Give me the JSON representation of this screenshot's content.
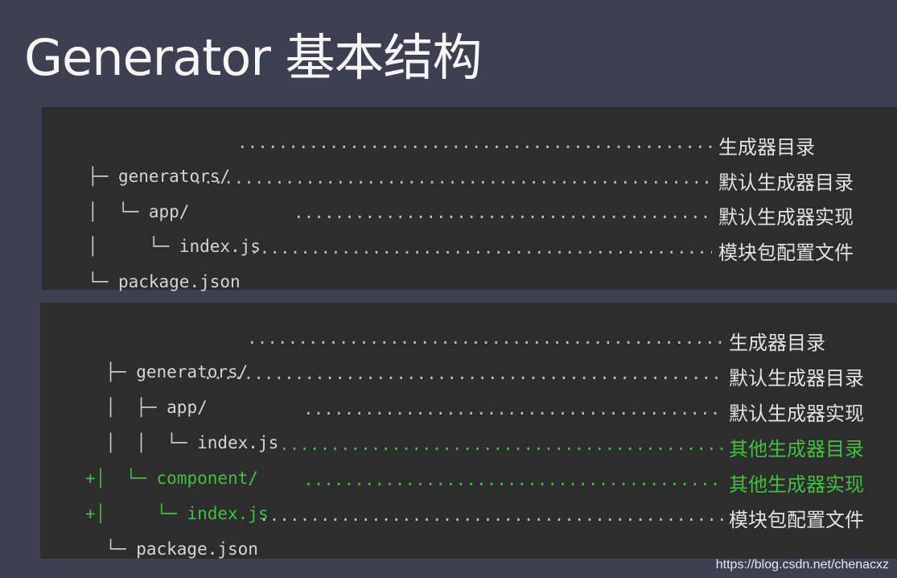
{
  "title": "Generator 基本结构",
  "tree_basic": [
    {
      "prefix": "├─ ",
      "name": "generators/",
      "dots": "································································",
      "desc": "生成器目录"
    },
    {
      "prefix": "│  └─ ",
      "name": "app/",
      "dots": "································································",
      "desc": "默认生成器目录"
    },
    {
      "prefix": "│     └─ ",
      "name": "index.js",
      "dots": "································································",
      "desc": "默认生成器实现"
    },
    {
      "prefix": "└─ ",
      "name": "package.json",
      "dots": "································································",
      "desc": "模块包配置文件"
    }
  ],
  "tree_extended": [
    {
      "prefix": "  ├─ ",
      "name": "generators/",
      "dots": "································································",
      "desc": "生成器目录"
    },
    {
      "prefix": "  │  ├─ ",
      "name": "app/",
      "dots": "································································",
      "desc": "默认生成器目录"
    },
    {
      "prefix": "  │  │  └─ ",
      "name": "index.js",
      "dots": "································································",
      "desc": "默认生成器实现"
    },
    {
      "prefix": "+│  └─ ",
      "name": "component/",
      "dots": "································································",
      "desc": "其他生成器目录"
    },
    {
      "prefix": "+│     └─ ",
      "name": "index.js",
      "dots": "································································",
      "desc": "其他生成器实现"
    },
    {
      "prefix": "  └─ ",
      "name": "package.json",
      "dots": "································································",
      "desc": "模块包配置文件"
    }
  ],
  "watermark": "https://blog.csdn.net/chenacxz"
}
